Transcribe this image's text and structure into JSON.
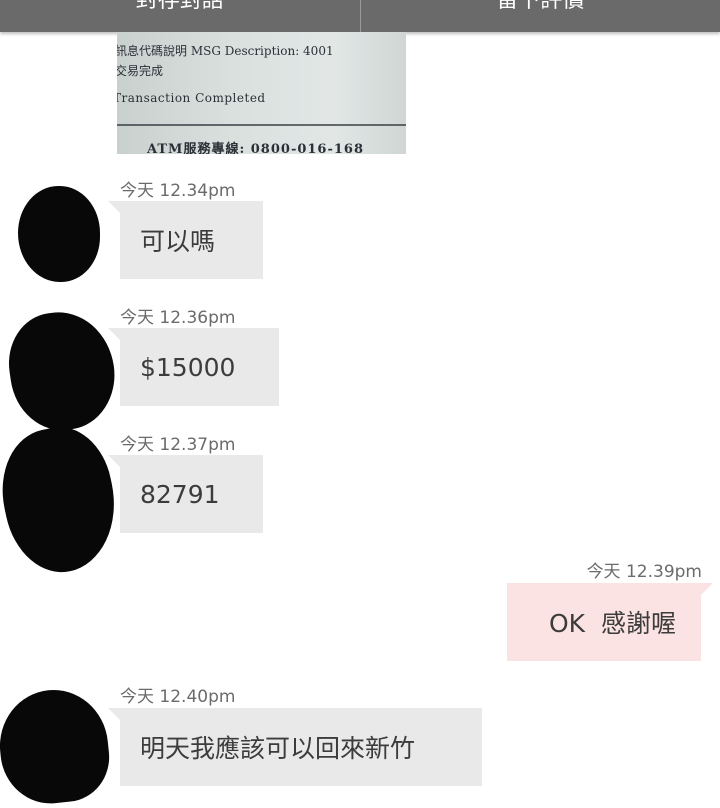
{
  "header": {
    "tabs": [
      {
        "label": "封存對話"
      },
      {
        "label": "留下評價"
      }
    ]
  },
  "receipt_photo": {
    "lines": [
      "訊息代碼說明 MSG Description: 4001",
      "交易完成",
      "Transaction Completed",
      "ATM服務專線: 0800-016-168"
    ]
  },
  "messages": [
    {
      "sender": "other",
      "time": "今天 12.34pm",
      "text": "可以嗎"
    },
    {
      "sender": "other",
      "time": "今天 12.36pm",
      "text": "$15000"
    },
    {
      "sender": "other",
      "time": "今天 12.37pm",
      "text": "82791"
    },
    {
      "sender": "self",
      "time": "今天 12.39pm",
      "text": "OK  感謝喔"
    },
    {
      "sender": "other",
      "time": "今天 12.40pm",
      "text": "明天我應該可以回來新竹"
    }
  ],
  "colors": {
    "header_bg": "#6a6a6a",
    "incoming_bubble": "#e9e9e9",
    "outgoing_bubble": "#fbe3e3",
    "timestamp_text": "#6b6b6b"
  }
}
